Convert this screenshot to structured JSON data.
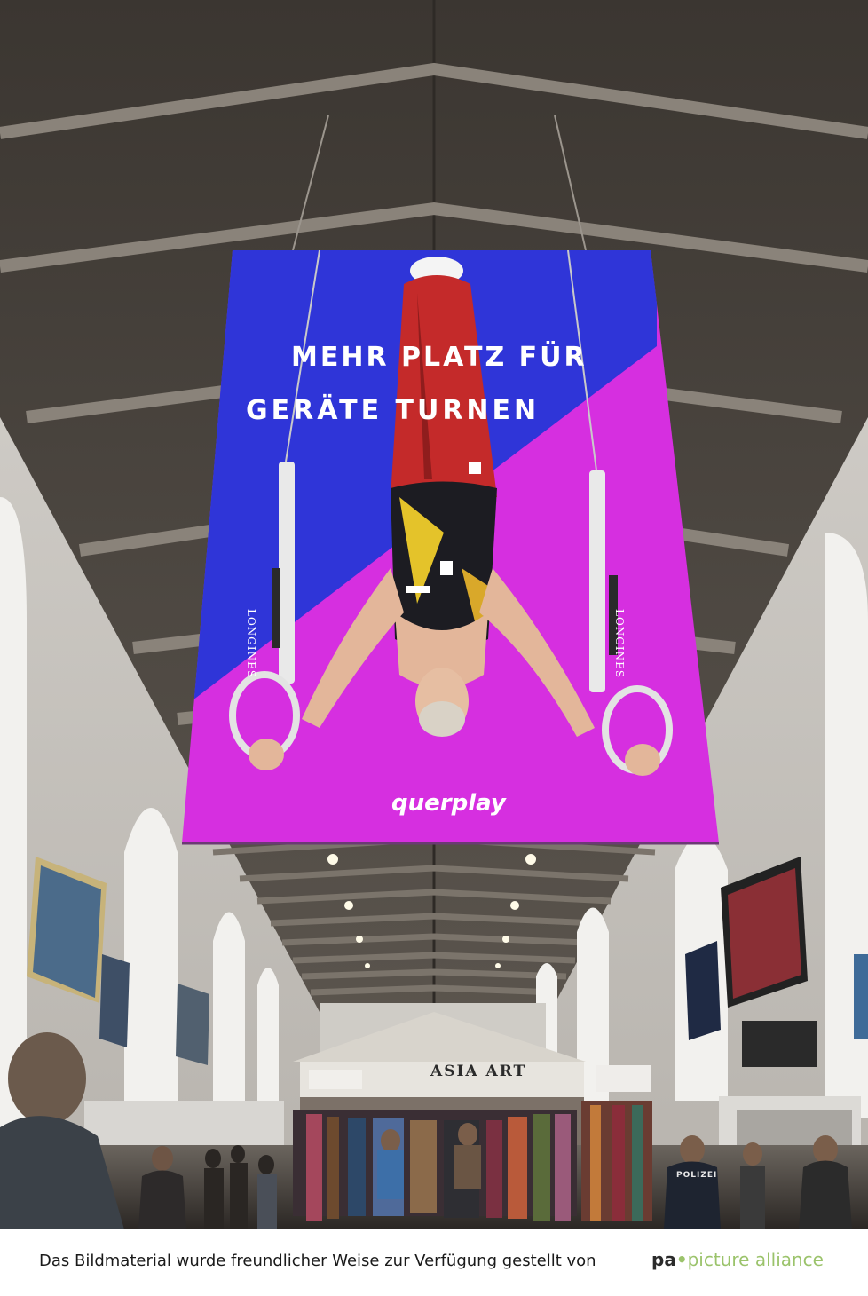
{
  "banner": {
    "headline_line1": "MEHR PLATZ FÜR",
    "headline_line2": "GERÄTE TURNEN",
    "logo_text": "querplay",
    "ring_brand": "LONGINES",
    "colors": {
      "blue": "#2f35d8",
      "magenta": "#d62fe0"
    }
  },
  "station": {
    "kiosk_sign": "ASIA ART",
    "police_label": "POLIZEI"
  },
  "footer": {
    "credit_text": "Das Bildmaterial wurde freundlicher Weise zur Verfügung gestellt von",
    "agency_logo_pa": "pa",
    "agency_logo_dot": "•",
    "agency_logo_name": "picture alliance",
    "agency_color": "#9bc36b"
  }
}
